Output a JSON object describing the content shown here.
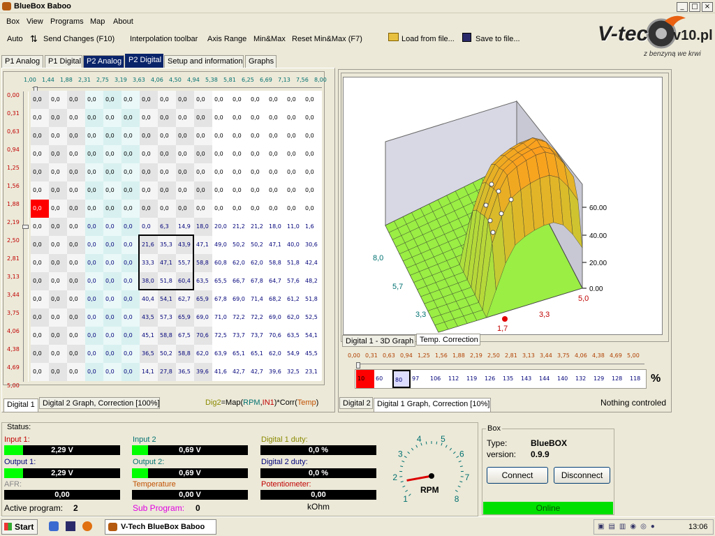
{
  "window": {
    "title": "BlueBox Baboo",
    "min": "_",
    "max": "□",
    "close": "×"
  },
  "menu": [
    "Box",
    "View",
    "Programs",
    "Map",
    "About"
  ],
  "toolbar": {
    "auto": "Auto",
    "send": "Send Changes (F10)",
    "interp": "Interpolation toolbar",
    "axis": "Axis Range",
    "minmax": "Min&Max",
    "reset": "Reset Min&Max (F7)",
    "load": "Load from file...",
    "save": "Save to file..."
  },
  "logo": {
    "text": "V-tec",
    "site": "v10.pl",
    "slogan": "z benzyną we krwi"
  },
  "tabs": [
    "P1 Analog",
    "P1 Digital",
    "P2 Analog",
    "P2 Digital",
    "Setup and information",
    "Graphs"
  ],
  "col_headers": [
    "1,00",
    "1,44",
    "1,88",
    "2,31",
    "2,75",
    "3,19",
    "3,63",
    "4,06",
    "4,50",
    "4,94",
    "5,38",
    "5,81",
    "6,25",
    "6,69",
    "7,13",
    "7,56",
    "8,00"
  ],
  "row_headers": [
    "0,00",
    "0,31",
    "0,63",
    "0,94",
    "1,25",
    "1,56",
    "1,88",
    "2,19",
    "2,50",
    "2,81",
    "3,13",
    "3,44",
    "3,75",
    "4,06",
    "4,38",
    "4,69",
    "5,00"
  ],
  "grid": [
    [
      "0,0",
      "0,0",
      "0,0",
      "0,0",
      "0,0",
      "0,0",
      "0,0",
      "0,0",
      "0,0",
      "0,0",
      "0,0",
      "0,0",
      "0,0",
      "0,0",
      "0,0",
      "0,0"
    ],
    [
      "0,0",
      "0,0",
      "0,0",
      "0,0",
      "0,0",
      "0,0",
      "0,0",
      "0,0",
      "0,0",
      "0,0",
      "0,0",
      "0,0",
      "0,0",
      "0,0",
      "0,0",
      "0,0"
    ],
    [
      "0,0",
      "0,0",
      "0,0",
      "0,0",
      "0,0",
      "0,0",
      "0,0",
      "0,0",
      "0,0",
      "0,0",
      "0,0",
      "0,0",
      "0,0",
      "0,0",
      "0,0",
      "0,0"
    ],
    [
      "0,0",
      "0,0",
      "0,0",
      "0,0",
      "0,0",
      "0,0",
      "0,0",
      "0,0",
      "0,0",
      "0,0",
      "0,0",
      "0,0",
      "0,0",
      "0,0",
      "0,0",
      "0,0"
    ],
    [
      "0,0",
      "0,0",
      "0,0",
      "0,0",
      "0,0",
      "0,0",
      "0,0",
      "0,0",
      "0,0",
      "0,0",
      "0,0",
      "0,0",
      "0,0",
      "0,0",
      "0,0",
      "0,0"
    ],
    [
      "0,0",
      "0,0",
      "0,0",
      "0,0",
      "0,0",
      "0,0",
      "0,0",
      "0,0",
      "0,0",
      "0,0",
      "0,0",
      "0,0",
      "0,0",
      "0,0",
      "0,0",
      "0,0"
    ],
    [
      "0,0",
      "0,0",
      "0,0",
      "0,0",
      "0,0",
      "0,0",
      "0,0",
      "0,0",
      "0,0",
      "0,0",
      "0,0",
      "0,0",
      "0,0",
      "0,0",
      "0,0",
      "0,0"
    ],
    [
      "0,0",
      "0,0",
      "0,0",
      "0,0",
      "0,0",
      "0,0",
      "0,0",
      "6,3",
      "14,9",
      "18,0",
      "20,0",
      "21,2",
      "21,2",
      "18,0",
      "11,0",
      "1,6"
    ],
    [
      "0,0",
      "0,0",
      "0,0",
      "0,0",
      "0,0",
      "0,0",
      "21,6",
      "35,3",
      "43,9",
      "47,1",
      "49,0",
      "50,2",
      "50,2",
      "47,1",
      "40,0",
      "30,6"
    ],
    [
      "0,0",
      "0,0",
      "0,0",
      "0,0",
      "0,0",
      "0,0",
      "33,3",
      "47,1",
      "55,7",
      "58,8",
      "60,8",
      "62,0",
      "62,0",
      "58,8",
      "51,8",
      "42,4"
    ],
    [
      "0,0",
      "0,0",
      "0,0",
      "0,0",
      "0,0",
      "0,0",
      "38,0",
      "51,8",
      "60,4",
      "63,5",
      "65,5",
      "66,7",
      "67,8",
      "64,7",
      "57,6",
      "48,2"
    ],
    [
      "0,0",
      "0,0",
      "0,0",
      "0,0",
      "0,0",
      "0,0",
      "40,4",
      "54,1",
      "62,7",
      "65,9",
      "67,8",
      "69,0",
      "71,4",
      "68,2",
      "61,2",
      "51,8"
    ],
    [
      "0,0",
      "0,0",
      "0,0",
      "0,0",
      "0,0",
      "0,0",
      "43,5",
      "57,3",
      "65,9",
      "69,0",
      "71,0",
      "72,2",
      "72,2",
      "69,0",
      "62,0",
      "52,5"
    ],
    [
      "0,0",
      "0,0",
      "0,0",
      "0,0",
      "0,0",
      "0,0",
      "45,1",
      "58,8",
      "67,5",
      "70,6",
      "72,5",
      "73,7",
      "73,7",
      "70,6",
      "63,5",
      "54,1"
    ],
    [
      "0,0",
      "0,0",
      "0,0",
      "0,0",
      "0,0",
      "0,0",
      "36,5",
      "50,2",
      "58,8",
      "62,0",
      "63,9",
      "65,1",
      "65,1",
      "62,0",
      "54,9",
      "45,5"
    ],
    [
      "0,0",
      "0,0",
      "0,0",
      "0,0",
      "0,0",
      "0,0",
      "14,1",
      "27,8",
      "36,5",
      "39,6",
      "41,6",
      "42,7",
      "42,7",
      "39,6",
      "32,5",
      "23,1"
    ]
  ],
  "left_tabs": {
    "digital1": "Digital 1",
    "graph": "Digital 2 Graph, Correction [100%]"
  },
  "formula": {
    "dig2": "Dig2",
    "eq": "=Map(",
    "rpm": "RPM",
    "comma": ",",
    "in1": "IN1",
    "corr": ")*Corr(",
    "temp": "Temp",
    "end": ")"
  },
  "chart_tabs": {
    "d3": "Digital 1 - 3D Graph",
    "temp": "Temp. Correction"
  },
  "chart_labels": {
    "z0": "0.00",
    "z20": "20.00",
    "z40": "40.00",
    "z60": "60.00",
    "x8": "8,0",
    "x57": "5,7",
    "x33a": "3,3",
    "y17": "1,7",
    "y33": "3,3",
    "y50": "5,0"
  },
  "corr_headers": [
    "0,00",
    "0,31",
    "0,63",
    "0,94",
    "1,25",
    "1,56",
    "1,88",
    "2,19",
    "2,50",
    "2,81",
    "3,13",
    "3,44",
    "3,75",
    "4,06",
    "4,38",
    "4,69",
    "5,00"
  ],
  "corr_values": [
    "10",
    "60",
    "80",
    "97",
    "106",
    "112",
    "119",
    "126",
    "135",
    "143",
    "144",
    "140",
    "132",
    "129",
    "128",
    "118"
  ],
  "corr_unit": "%",
  "right_tabs": {
    "digital2": "Digital 2",
    "graph": "Digital 1 Graph, Correction [10%]"
  },
  "nothing": "Nothing controled",
  "status": {
    "title": "Status:",
    "input1": {
      "label": "Input 1:",
      "value": "2,29 V",
      "fill": 0.16
    },
    "output1": {
      "label": "Output 1:",
      "value": "2,29 V",
      "fill": 0.16
    },
    "afr": {
      "label": "AFR:",
      "value": "0,00",
      "fill": 0
    },
    "active": {
      "label": "Active program:",
      "value": "2"
    },
    "input2": {
      "label": "Input 2",
      "value": "0,69 V",
      "fill": 0.14
    },
    "output2": {
      "label": "Output 2:",
      "value": "0,69 V",
      "fill": 0.14
    },
    "temperature": {
      "label": "Temperature",
      "value": "0,00 V",
      "fill": 0
    },
    "sub": {
      "label": "Sub Program:",
      "value": "0"
    },
    "d1duty": {
      "label": "Digital 1 duty:",
      "value": "0,0 %"
    },
    "d2duty": {
      "label": "Digital 2 duty:",
      "value": "0,0 %"
    },
    "pot": {
      "label": "Potentiometer:",
      "value": "0,00",
      "unit": "kOhm"
    }
  },
  "gauge": {
    "label": "RPM",
    "ticks": [
      "1",
      "2",
      "3",
      "4",
      "5",
      "6",
      "7",
      "8"
    ],
    "value": 1.9
  },
  "box": {
    "title": "Box",
    "type_label": "Type:",
    "type_value": "BlueBOX",
    "version_label": "version:",
    "version_value": "0.9.9",
    "connect": "Connect",
    "disconnect": "Disconnect",
    "online": "Online"
  },
  "taskbar": {
    "start": "Start",
    "task": "V-Tech BlueBox Baboo",
    "clock": "13:06"
  },
  "colors": {
    "accent": "#0a246a",
    "online": "#00e000",
    "header_red": "#c00000",
    "header_teal": "#007070"
  }
}
